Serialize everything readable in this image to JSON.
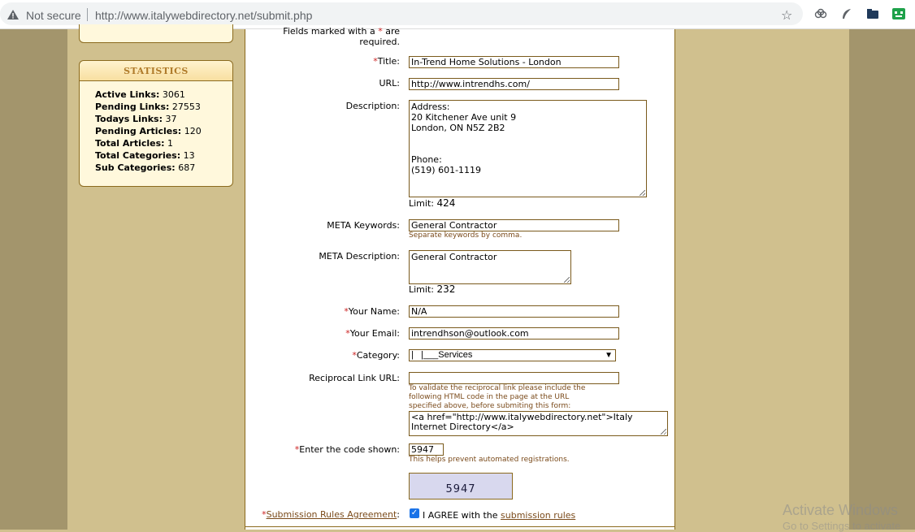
{
  "browser": {
    "security_label": "Not secure",
    "url": "http://www.italywebdirectory.net/submit.php"
  },
  "sidebar": {
    "stats_title": "STATISTICS",
    "stats": [
      {
        "label": "Active Links:",
        "value": "3061"
      },
      {
        "label": "Pending Links:",
        "value": "27553"
      },
      {
        "label": "Todays Links:",
        "value": "37"
      },
      {
        "label": "Pending Articles:",
        "value": "120"
      },
      {
        "label": "Total Articles:",
        "value": "1"
      },
      {
        "label": "Total Categories:",
        "value": "13"
      },
      {
        "label": "Sub Categories:",
        "value": "687"
      }
    ]
  },
  "form": {
    "required_note_1": "Fields marked with a",
    "required_star": "*",
    "required_note_2": "are",
    "required_note_3": "required.",
    "title": {
      "label": "Title:",
      "value": "In-Trend Home Solutions - London"
    },
    "url": {
      "label": "URL:",
      "value": "http://www.intrendhs.com/"
    },
    "description": {
      "label": "Description:",
      "value": "Address:\n20 Kitchener Ave unit 9\nLondon, ON N5Z 2B2\n\n\nPhone:\n(519) 601-1119",
      "limit_label": "Limit:",
      "limit_value": "424"
    },
    "meta_keywords": {
      "label": "META Keywords:",
      "value": "General Contractor",
      "hint": "Separate keywords by comma."
    },
    "meta_description": {
      "label": "META Description:",
      "value": "General Contractor",
      "limit_label": "Limit:",
      "limit_value": "232"
    },
    "your_name": {
      "label": "Your Name:",
      "value": "N/A"
    },
    "your_email": {
      "label": "Your Email:",
      "value": "intrendhson@outlook.com"
    },
    "category": {
      "label": "Category:",
      "value": "|   |___Services"
    },
    "reciprocal": {
      "label": "Reciprocal Link URL:",
      "value": "",
      "hint_1": "To validate the reciprocal link please include the",
      "hint_2": "following HTML code in the page at the URL",
      "hint_3": "specified above, before submiting this form:",
      "code": "<a href=\"http://www.italywebdirectory.net\">Italy\nInternet Directory</a>"
    },
    "code": {
      "label": "Enter the code shown:",
      "value": "5947",
      "hint": "This helps prevent automated registrations.",
      "captcha_text": "5947"
    },
    "agreement": {
      "label": "Submission Rules Agreement",
      "colon": ":",
      "check_text": "I AGREE with the",
      "rules_link": "submission rules"
    }
  },
  "watermark": {
    "line1": "Activate Windows",
    "line2": "Go to Settings to activate"
  }
}
